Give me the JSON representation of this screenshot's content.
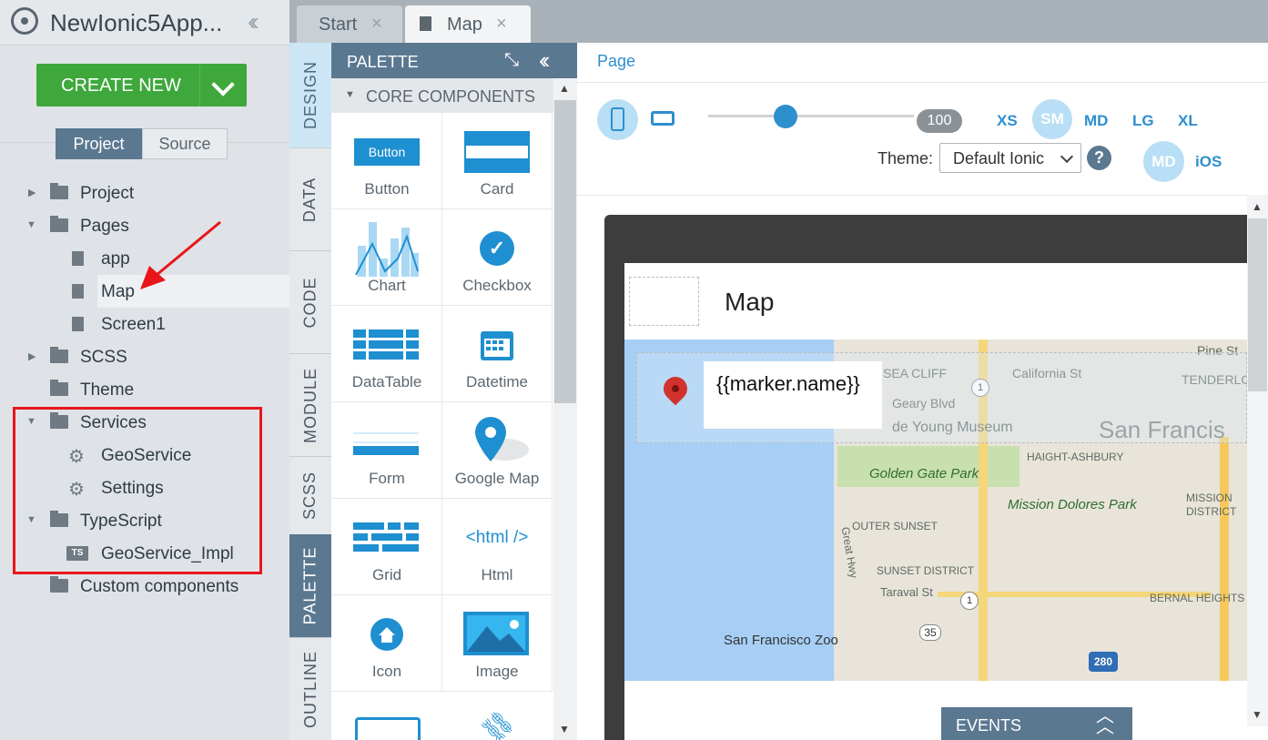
{
  "app": {
    "title": "NewIonic5App...",
    "create_new": "CREATE NEW"
  },
  "sidebar": {
    "tabs": [
      "Project",
      "Source"
    ],
    "tree": [
      {
        "label": "Project",
        "type": "folder",
        "expanded": false
      },
      {
        "label": "Pages",
        "type": "folder",
        "expanded": true
      },
      {
        "label": "app",
        "type": "page"
      },
      {
        "label": "Map",
        "type": "page",
        "selected": true
      },
      {
        "label": "Screen1",
        "type": "page"
      },
      {
        "label": "SCSS",
        "type": "folder",
        "expanded": false
      },
      {
        "label": "Theme",
        "type": "folder"
      },
      {
        "label": "Services",
        "type": "folder",
        "expanded": true
      },
      {
        "label": "GeoService",
        "type": "gear"
      },
      {
        "label": "Settings",
        "type": "gear"
      },
      {
        "label": "TypeScript",
        "type": "folder",
        "expanded": true
      },
      {
        "label": "GeoService_Impl",
        "type": "ts",
        "badge": "TS"
      },
      {
        "label": "Custom components",
        "type": "folder"
      }
    ]
  },
  "editor_tabs": [
    {
      "label": "Start",
      "icon": "none"
    },
    {
      "label": "Map",
      "icon": "page-icon",
      "active": true
    }
  ],
  "vertical_tabs": [
    "DESIGN",
    "DATA",
    "CODE",
    "MODULE",
    "SCSS",
    "PALETTE",
    "OUTLINE"
  ],
  "palette": {
    "title": "PALETTE",
    "section": "CORE COMPONENTS",
    "items": [
      "Button",
      "Card",
      "Chart",
      "Checkbox",
      "DataTable",
      "Datetime",
      "Form",
      "Google Map",
      "Grid",
      "Html",
      "Icon",
      "Image"
    ],
    "button_icon_text": "Button",
    "html_icon_text": "<html />"
  },
  "main": {
    "breadcrumb": "Page",
    "zoom": "100",
    "breakpoints": [
      "XS",
      "SM",
      "MD",
      "LG",
      "XL"
    ],
    "active_breakpoint": "SM",
    "theme_label": "Theme:",
    "theme_value": "Default Ionic",
    "help": "?",
    "modes": [
      "MD",
      "iOS"
    ],
    "page_title": "Map",
    "marker_text": "{{marker.name}}",
    "events": "EVENTS"
  },
  "map_labels": [
    "Pine St",
    "SEA CLIFF",
    "California St",
    "TENDERLOIN",
    "Geary Blvd",
    "de Young Museum",
    "San Francis",
    "HAIGHT-ASHBURY",
    "Golden Gate Park",
    "Mission Dolores Park",
    "MISSION",
    "DISTRICT",
    "OUTER SUNSET",
    "SUNSET DISTRICT",
    "Taraval St",
    "Great Hwy",
    "BERNAL HEIGHTS",
    "San Francisco Zoo",
    "35",
    "280",
    "1",
    "1"
  ],
  "colors": {
    "accent": "#2e8fcf",
    "create": "#3ea83c",
    "nav": "#5b7891",
    "annotation": "#e8161b"
  }
}
